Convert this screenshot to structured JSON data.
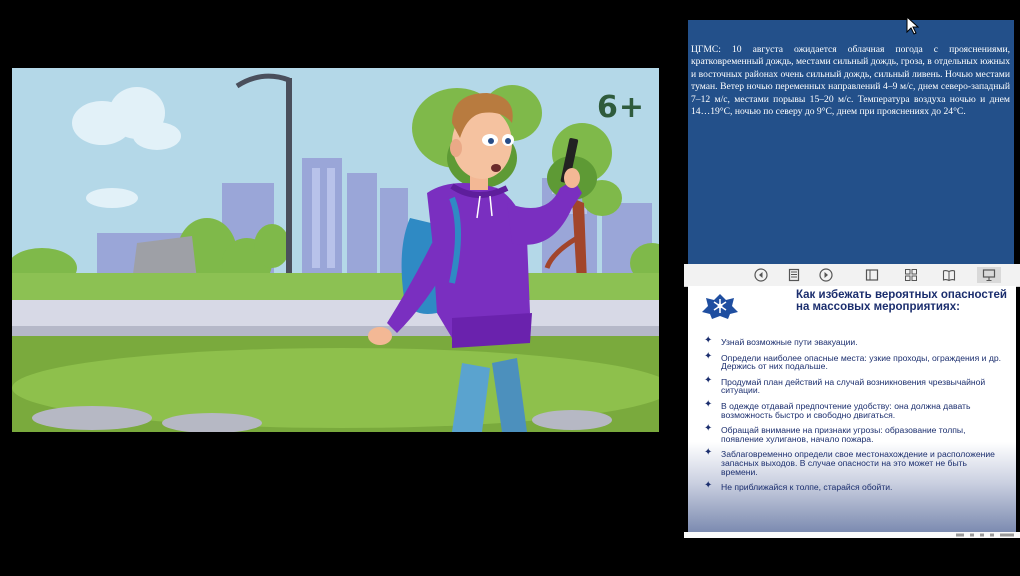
{
  "video": {
    "age_rating": "6+"
  },
  "weather": {
    "text": "ЦГМС: 10 августа ожидается облачная погода с прояснениями, кратковременный дождь, местами сильный дождь, гроза, в отдельных южных и восточных районах очень сильный дождь, сильный ливень. Ночью местами туман. Ветер ночью переменных направлений 4–9 м/с, днем северо-западный 7–12 м/с, местами порывы 15–20 м/с. Температура воздуха ночью и днем 14…19°C, ночью по северу до 9°C, днем при прояснениях до 24°C."
  },
  "toolbar": {
    "buttons": [
      "prev-icon",
      "notes-icon",
      "next-icon",
      "normal-view-icon",
      "slide-sorter-icon",
      "reading-view-icon",
      "slideshow-icon"
    ]
  },
  "slide": {
    "title": "Как избежать вероятных опасностей на массовых мероприятиях:",
    "bullet_glyph": "✦",
    "tips": [
      "Узнай возможные пути эвакуации.",
      "Определи наиболее опасные места: узкие проходы, ограждения и др. Держись от них подальше.",
      "Продумай план действий на случай возникновения чрезвычайной ситуации.",
      "В одежде отдавай предпочтение удобству: она должна давать возможность быстро и свободно двигаться.",
      "Обращай внимание на признаки угрозы: образование толпы, появление хулиганов, начало пожара.",
      "Заблаговременно определи свое местонахождение и расположение запасных выходов. В случае опасности на это может не быть времени.",
      "Не приближайся к толпе, старайся обойти."
    ]
  },
  "colors": {
    "weather_bg": "#23508a",
    "slide_title": "#1b2e6e",
    "hoodie": "#7a2fc0"
  }
}
